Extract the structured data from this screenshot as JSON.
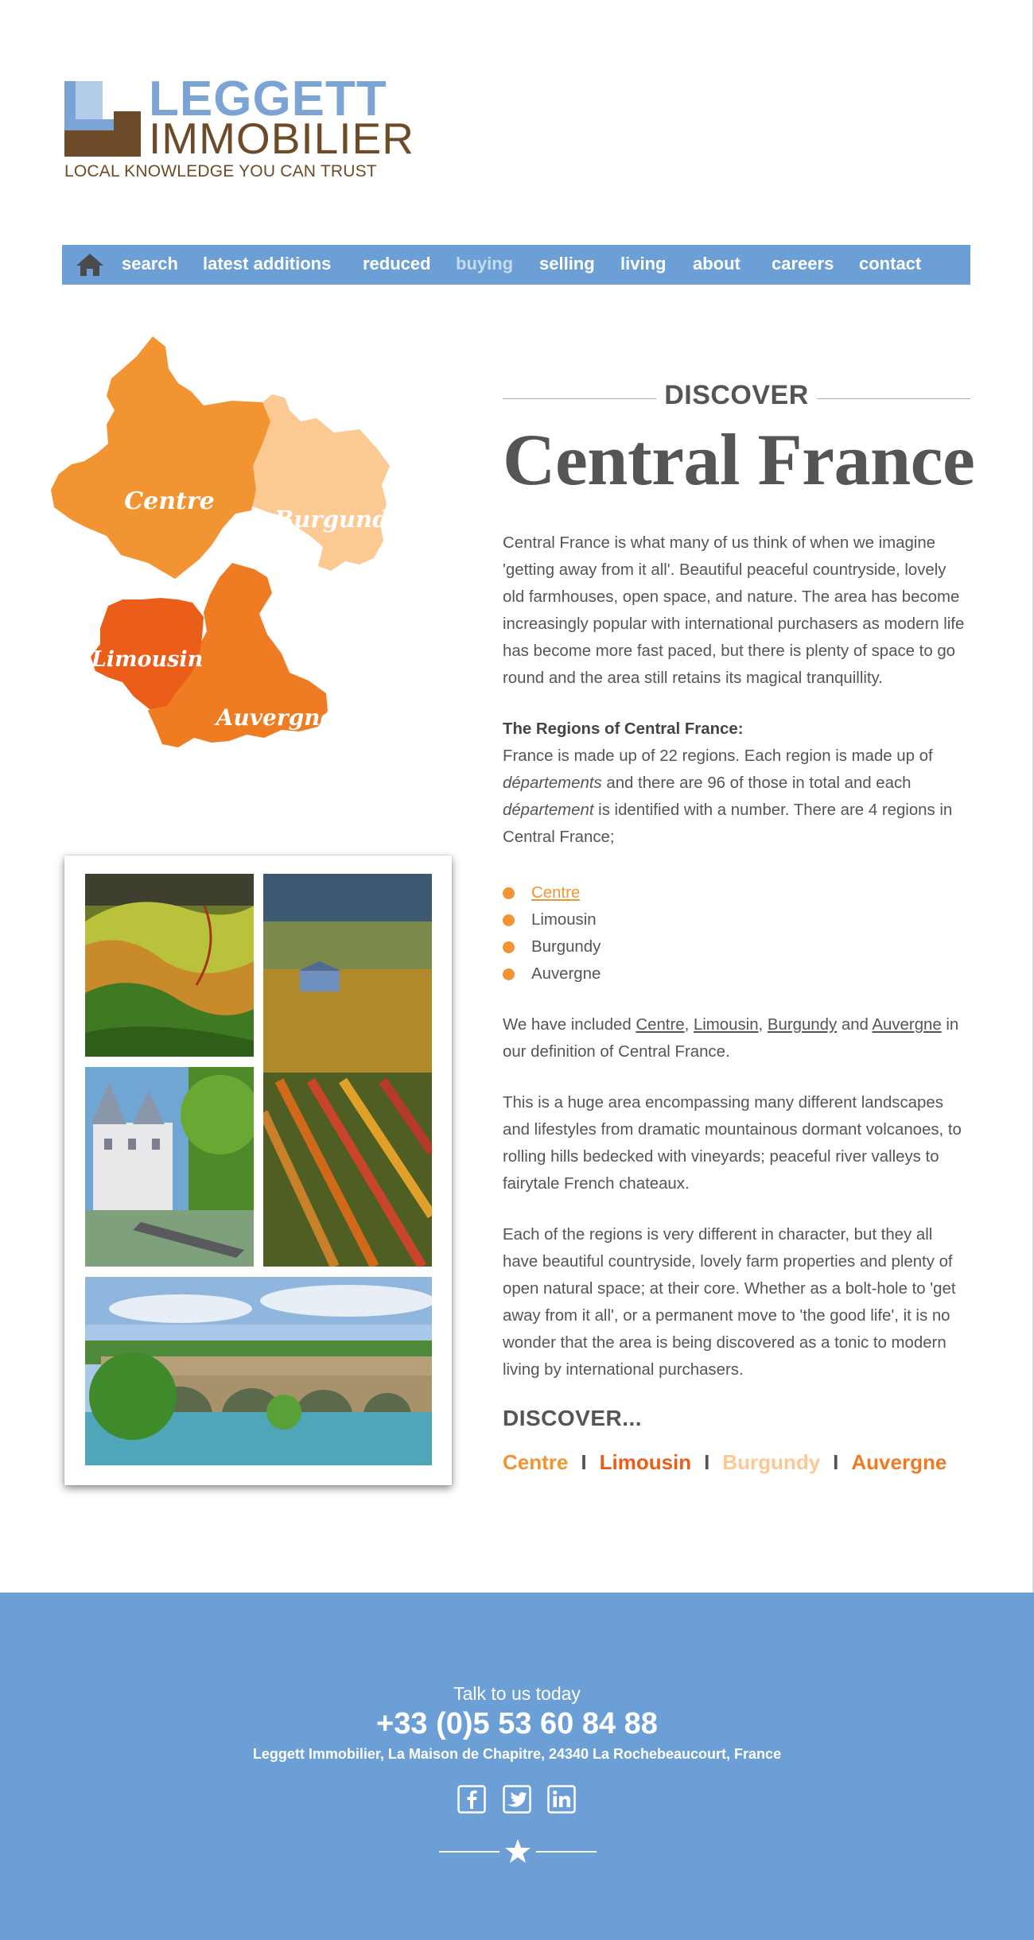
{
  "logo": {
    "word1": "LEGGETT",
    "word2": "IMMOBILIER",
    "tagline": "LOCAL KNOWLEDGE YOU CAN TRUST",
    "colors": {
      "blue": "#7ba3d3",
      "light_blue": "#b4cde8",
      "brown": "#6e4b28"
    }
  },
  "nav": {
    "home_icon": "home-icon",
    "items": [
      "search",
      "latest additions",
      "reduced",
      "buying",
      "selling",
      "living",
      "about",
      "careers",
      "contact"
    ],
    "active": "buying",
    "color": "#6b9fd6"
  },
  "map": {
    "labels": [
      "Centre",
      "Burgundy",
      "Limousin",
      "Auvergne"
    ],
    "colors": {
      "Centre": "#f29431",
      "Burgundy": "#fcc993",
      "Limousin": "#eb5e1a",
      "Auvergne": "#ef7b22"
    }
  },
  "content": {
    "kicker": "DISCOVER",
    "title": "Central France",
    "intro": "Central France is what many of us think of when we imagine 'getting away from it all'.  Beautiful peaceful countryside, lovely old farmhouses, open space, and nature.  The area has become increasingly popular with international purchasers as modern life has become more fast paced, but there is plenty of space to go round and the area still retains its magical tranquillity.",
    "regions_heading": "The Regions of Central France:",
    "regions_text_1": "France is made up of 22 regions. Each region is made up of ",
    "regions_italic_1": "départements",
    "regions_text_2": " and there are 96 of those in total and each ",
    "regions_italic_2": "département",
    "regions_text_3": " is identified with a number. There are 4 regions in Central France;",
    "region_list": [
      "Centre",
      "Limousin",
      "Burgundy",
      "Auvergne"
    ],
    "included_1": "We have included ",
    "included_links": [
      "Centre",
      "Limousin",
      "Burgundy",
      "Auvergne"
    ],
    "included_and": " and ",
    "included_2": " in our definition of Central France.",
    "para_landscape": "This is a huge area encompassing many different landscapes and lifestyles from dramatic mountainous dormant volcanoes, to rolling hills bedecked with vineyards; peaceful river valleys to fairytale French chateaux.",
    "para_character": "Each of the regions is very different in character, but they all have beautiful countryside, lovely farm properties and plenty of open natural space; at their core.  Whether as a bolt-hole to 'get away from it all', or a permanent move to 'the good life', it is no wonder that the area is being discovered as a tonic to modern living by international purchasers.",
    "discover_small": "DISCOVER...",
    "discover_links": [
      {
        "label": "Centre",
        "color": "#f29431"
      },
      {
        "label": "Limousin",
        "color": "#eb5e1a"
      },
      {
        "label": "Burgundy",
        "color": "#fcc993"
      },
      {
        "label": "Auvergne",
        "color": "#ef7b22"
      }
    ],
    "separator": "I",
    "accent": "#f29431"
  },
  "footer": {
    "talk": "Talk to us today",
    "phone": "+33 (0)5 53 60 84 88",
    "address": "Leggett Immobilier, La Maison de Chapitre, 24340 La Rochebeaucourt, France",
    "social_icons": [
      "facebook-icon",
      "twitter-icon",
      "linkedin-icon"
    ],
    "color": "#6b9fd6"
  }
}
